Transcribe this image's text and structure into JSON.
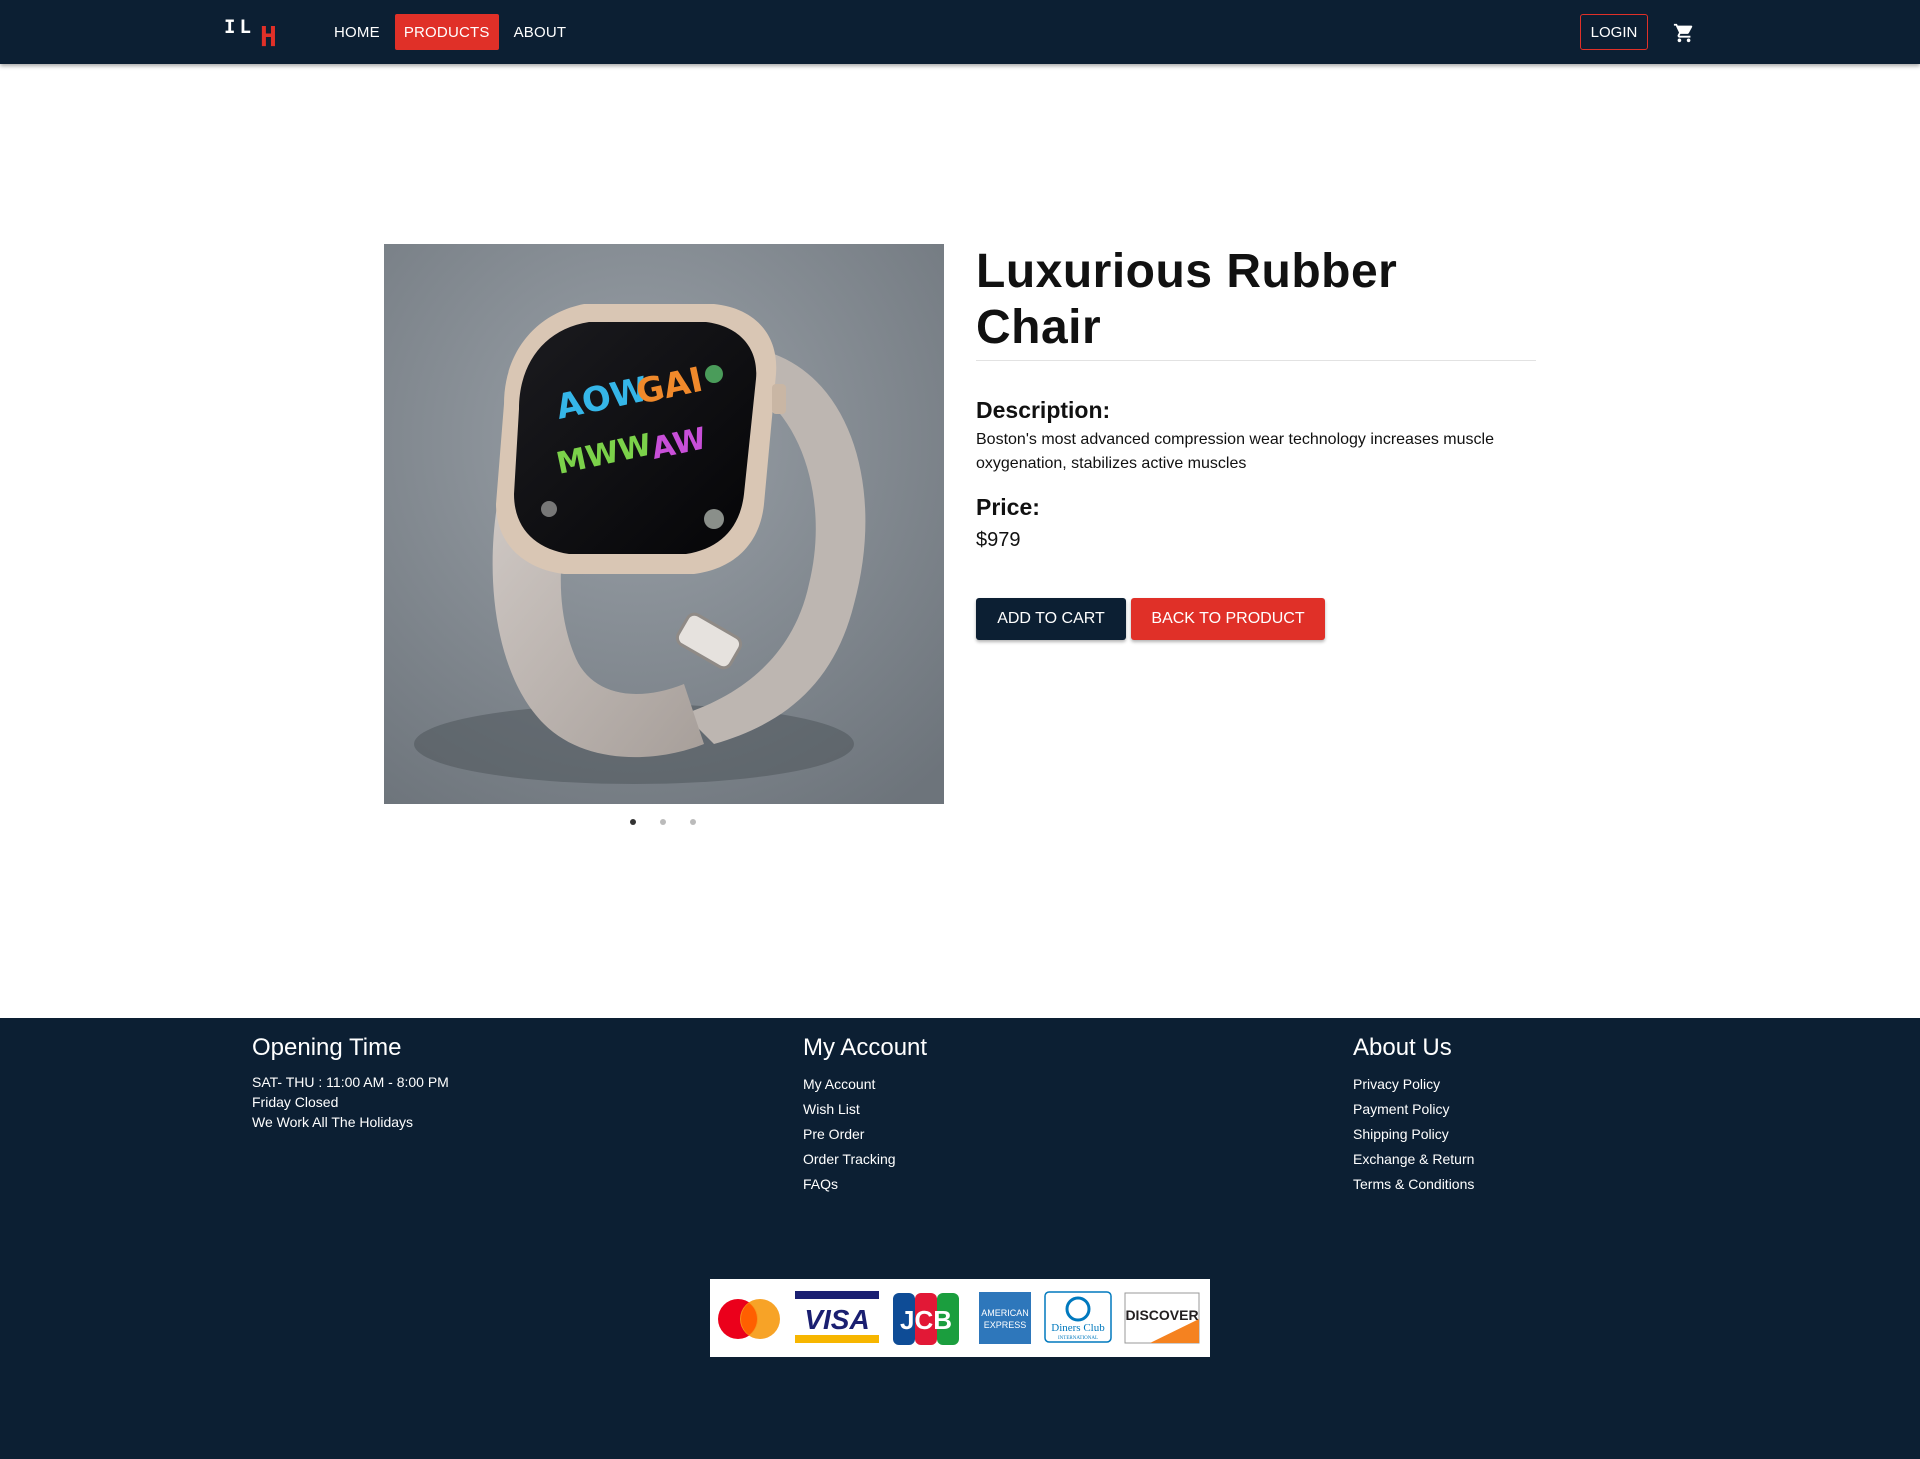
{
  "header": {
    "logo_left": "IL",
    "logo_right": "H",
    "nav": [
      {
        "label": "HOME"
      },
      {
        "label": "PRODUCTS",
        "active": true
      },
      {
        "label": "ABOUT"
      }
    ],
    "login_label": "LOGIN",
    "cart_icon": "shopping-cart-icon"
  },
  "product": {
    "title": "Luxurious Rubber Chair",
    "description_label": "Description:",
    "description": "Boston's most advanced compression wear technology increases muscle oxygenation, stabilizes active muscles",
    "price_label": "Price:",
    "price": "$979",
    "add_to_cart_label": "ADD TO CART",
    "back_label": "BACK TO PRODUCT",
    "image_alt": "smart watch",
    "carousel": {
      "count": 3,
      "active_index": 0
    }
  },
  "footer": {
    "opening": {
      "title": "Opening Time",
      "lines": [
        "SAT- THU : 11:00 AM - 8:00 PM",
        "Friday Closed",
        "We Work All The Holidays"
      ]
    },
    "account": {
      "title": "My Account",
      "links": [
        "My Account",
        "Wish List",
        "Pre Order",
        "Order Tracking",
        "FAQs"
      ]
    },
    "about": {
      "title": "About Us",
      "links": [
        "Privacy Policy",
        "Payment Policy",
        "Shipping Policy",
        "Exchange & Return",
        "Terms & Conditions"
      ]
    },
    "payment_cards": [
      "mastercard",
      "VISA",
      "JCB",
      "AMERICAN EXPRESS",
      "Diners Club INTERNATIONAL",
      "DISCOVER"
    ]
  },
  "colors": {
    "navy": "#0c1f33",
    "accent_red": "#e03028"
  }
}
